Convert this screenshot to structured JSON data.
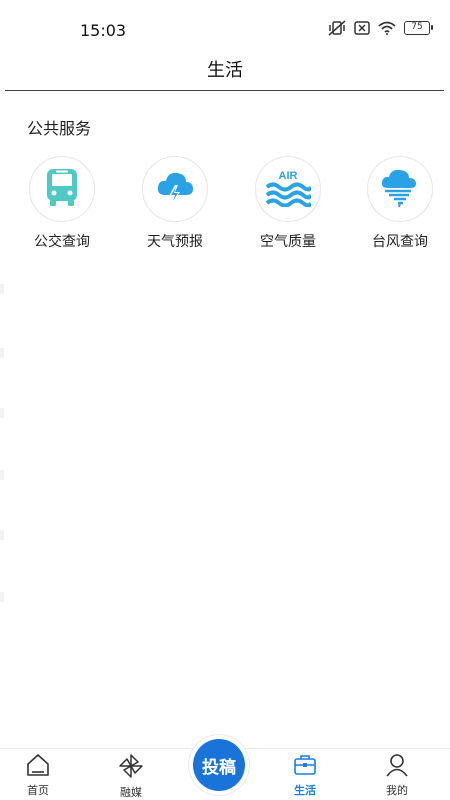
{
  "status_bar": {
    "time": "15:03",
    "battery": "75",
    "icons": [
      "mute-vibrate-icon",
      "no-sim-icon",
      "wifi-icon",
      "battery-icon"
    ]
  },
  "header": {
    "title": "生活"
  },
  "public_services": {
    "title": "公共服务",
    "items": [
      {
        "label": "公交查询",
        "icon": "bus-icon",
        "color": "#4ec9c4"
      },
      {
        "label": "天气预报",
        "icon": "storm-cloud-icon",
        "color": "#2aa3e6"
      },
      {
        "label": "空气质量",
        "icon": "air-quality-icon",
        "color": "#2aa3e6",
        "icon_text": "AIR"
      },
      {
        "label": "台风查询",
        "icon": "typhoon-icon",
        "color": "#2aa3e6"
      }
    ]
  },
  "bottom_nav": {
    "items": [
      {
        "label": "首页",
        "icon": "home-icon"
      },
      {
        "label": "融媒",
        "icon": "pinwheel-icon"
      },
      {
        "label": "生活",
        "icon": "briefcase-icon",
        "active": true
      },
      {
        "label": "我的",
        "icon": "user-icon"
      }
    ],
    "submit_label": "投稿",
    "active_color": "#1a7de0"
  }
}
